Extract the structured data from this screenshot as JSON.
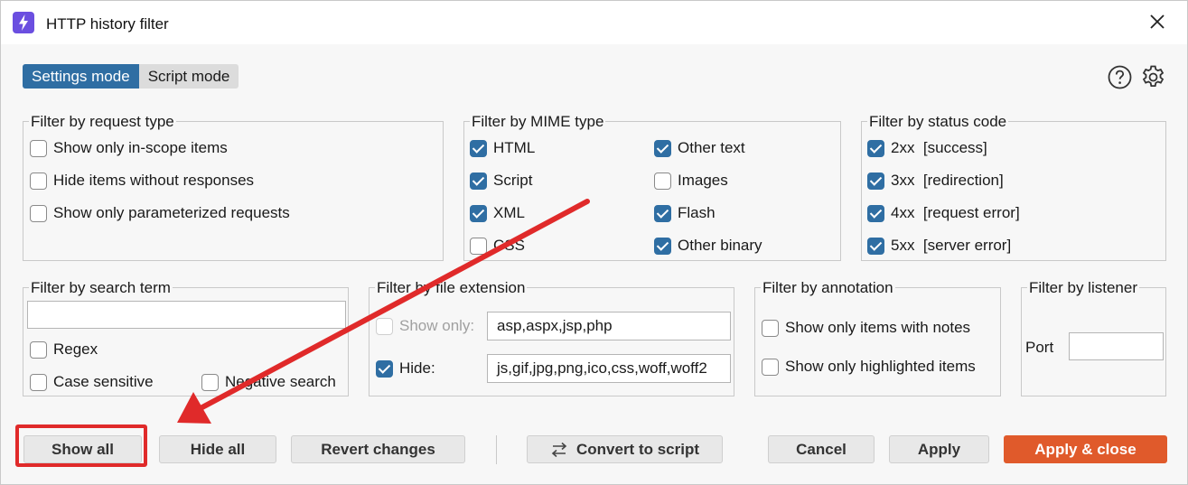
{
  "window": {
    "title": "HTTP history filter"
  },
  "mode_tabs": {
    "settings": "Settings mode",
    "script": "Script mode"
  },
  "request_type": {
    "title": "Filter by request type",
    "items": [
      {
        "label": "Show only in-scope items",
        "checked": false
      },
      {
        "label": "Hide items without responses",
        "checked": false
      },
      {
        "label": "Show only parameterized requests",
        "checked": false
      }
    ]
  },
  "mime_type": {
    "title": "Filter by MIME type",
    "items": [
      {
        "label": "HTML",
        "checked": true
      },
      {
        "label": "Other text",
        "checked": true
      },
      {
        "label": "Script",
        "checked": true
      },
      {
        "label": "Images",
        "checked": false
      },
      {
        "label": "XML",
        "checked": true
      },
      {
        "label": "Flash",
        "checked": true
      },
      {
        "label": "CSS",
        "checked": false
      },
      {
        "label": "Other binary",
        "checked": true
      }
    ]
  },
  "status_code": {
    "title": "Filter by status code",
    "items": [
      {
        "label": "2xx  [success]",
        "checked": true
      },
      {
        "label": "3xx  [redirection]",
        "checked": true
      },
      {
        "label": "4xx  [request error]",
        "checked": true
      },
      {
        "label": "5xx  [server error]",
        "checked": true
      }
    ]
  },
  "search_term": {
    "title": "Filter by search term",
    "value": "",
    "regex": "Regex",
    "case_sensitive": "Case sensitive",
    "negative": "Negative search"
  },
  "file_extension": {
    "title": "Filter by file extension",
    "show_only_label": "Show only:",
    "show_only_value": "asp,aspx,jsp,php",
    "hide_label": "Hide:",
    "hide_value": "js,gif,jpg,png,ico,css,woff,woff2"
  },
  "annotation": {
    "title": "Filter by annotation",
    "notes": "Show only items with notes",
    "highlighted": "Show only highlighted items"
  },
  "listener": {
    "title": "Filter by listener",
    "port_label": "Port",
    "port_value": ""
  },
  "buttons": {
    "show_all": "Show all",
    "hide_all": "Hide all",
    "revert": "Revert changes",
    "convert": "Convert to script",
    "cancel": "Cancel",
    "apply": "Apply",
    "apply_close": "Apply & close"
  },
  "colors": {
    "accent": "#2f6ea3",
    "primary_button": "#e05a2b",
    "annotation_red": "#e02a2a",
    "app_icon": "#6b4fe0"
  }
}
